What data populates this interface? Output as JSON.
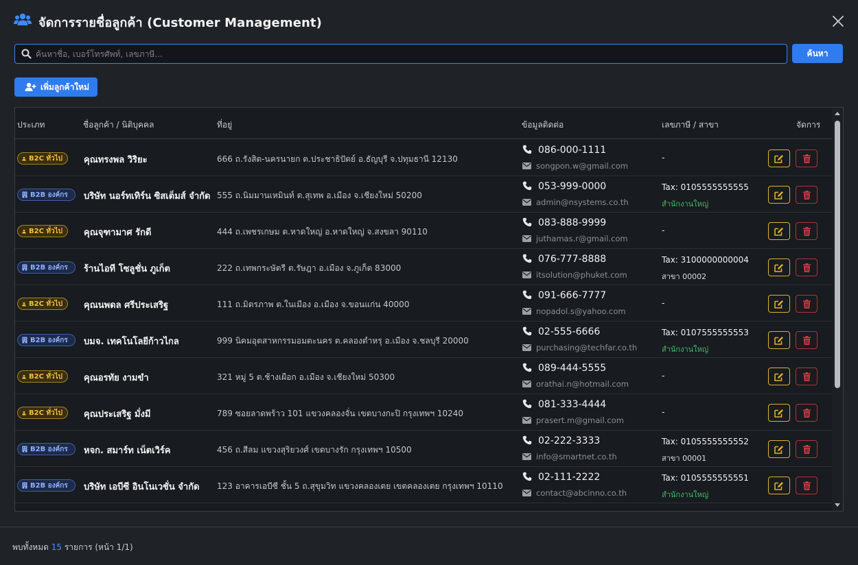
{
  "title": "จัดการรายชื่อลูกค้า (Customer Management)",
  "search": {
    "placeholder": "ค้นหาชื่อ, เบอร์โทรศัพท์, เลขภาษี...",
    "button": "ค้นหา"
  },
  "add_button": "เพิ่มลูกค้าใหม่",
  "columns": {
    "type": "ประเภท",
    "name": "ชื่อลูกค้า / นิติบุคคล",
    "address": "ที่อยู่",
    "contact": "ข้อมูลติดต่อ",
    "tax": "เลขภาษี / สาขา",
    "actions": "จัดการ"
  },
  "rows": [
    {
      "badge": "B2C ทั่วไป",
      "kind": "b2c",
      "name": "คุณทรงพล วิริยะ",
      "address": "666 ถ.รังสิต-นครนายก ต.ประชาธิปัตย์ อ.ธัญบุรี จ.ปทุมธานี 12130",
      "phone": "086-000-1111",
      "email": "songpon.w@gmail.com",
      "tax": "-",
      "branch": ""
    },
    {
      "badge": "B2B องค์กร",
      "kind": "b2b",
      "name": "บริษัท นอร์ทเทิร์น ซิสเต็มส์ จำกัด",
      "address": "555 ถ.นิมมานเหมินท์ ต.สุเทพ อ.เมือง จ.เชียงใหม่ 50200",
      "phone": "053-999-0000",
      "email": "admin@nsystems.co.th",
      "tax": "Tax: 0105555555555",
      "branch": "สำนักงานใหญ่",
      "branch_kind": "hq"
    },
    {
      "badge": "B2C ทั่วไป",
      "kind": "b2c",
      "name": "คุณจุฑามาศ รักดี",
      "address": "444 ถ.เพชรเกษม ต.หาดใหญ่ อ.หาดใหญ่ จ.สงขลา 90110",
      "phone": "083-888-9999",
      "email": "juthamas.r@gmail.com",
      "tax": "-",
      "branch": ""
    },
    {
      "badge": "B2B องค์กร",
      "kind": "b2b",
      "name": "ร้านไอที โซลูชั่น ภูเก็ต",
      "address": "222 ถ.เทพกระษัตรี ต.รัษฎา อ.เมือง จ.ภูเก็ต 83000",
      "phone": "076-777-8888",
      "email": "itsolution@phuket.com",
      "tax": "Tax: 3100000000004",
      "branch": "สาขา 00002",
      "branch_kind": "sub"
    },
    {
      "badge": "B2C ทั่วไป",
      "kind": "b2c",
      "name": "คุณนพดล ศรีประเสริฐ",
      "address": "111 ถ.มิตรภาพ ต.ในเมือง อ.เมือง จ.ขอนแก่น 40000",
      "phone": "091-666-7777",
      "email": "nopadol.s@yahoo.com",
      "tax": "-",
      "branch": ""
    },
    {
      "badge": "B2B องค์กร",
      "kind": "b2b",
      "name": "บมจ. เทคโนโลยีก้าวไกล",
      "address": "999 นิคมอุตสาหกรรมอมตะนคร ต.คลองตำหรุ อ.เมือง จ.ชลบุรี 20000",
      "phone": "02-555-6666",
      "email": "purchasing@techfar.co.th",
      "tax": "Tax: 0107555555553",
      "branch": "สำนักงานใหญ่",
      "branch_kind": "hq"
    },
    {
      "badge": "B2C ทั่วไป",
      "kind": "b2c",
      "name": "คุณอรทัย งามขำ",
      "address": "321 หมู่ 5 ต.ช้างเผือก อ.เมือง จ.เชียงใหม่ 50300",
      "phone": "089-444-5555",
      "email": "orathai.n@hotmail.com",
      "tax": "-",
      "branch": ""
    },
    {
      "badge": "B2C ทั่วไป",
      "kind": "b2c",
      "name": "คุณประเสริฐ มั่งมี",
      "address": "789 ซอยลาดพร้าว 101 แขวงคลองจั่น เขตบางกะปิ กรุงเทพฯ 10240",
      "phone": "081-333-4444",
      "email": "prasert.m@gmail.com",
      "tax": "-",
      "branch": ""
    },
    {
      "badge": "B2B องค์กร",
      "kind": "b2b",
      "name": "หจก. สมาร์ท เน็ตเวิร์ค",
      "address": "456 ถ.สีลม แขวงสุริยวงศ์ เขตบางรัก กรุงเทพฯ 10500",
      "phone": "02-222-3333",
      "email": "info@smartnet.co.th",
      "tax": "Tax: 0105555555552",
      "branch": "สาขา 00001",
      "branch_kind": "sub"
    },
    {
      "badge": "B2B องค์กร",
      "kind": "b2b",
      "name": "บริษัท เอบีซี อินโนเวชั่น จำกัด",
      "address": "123 อาคารเอบีซี ชั้น 5 ถ.สุขุมวิท แขวงคลองเตย เขตคลองเตย กรุงเทพฯ 10110",
      "phone": "02-111-2222",
      "email": "contact@abcinno.co.th",
      "tax": "Tax: 0105555555551",
      "branch": "สำนักงานใหญ่",
      "branch_kind": "hq"
    }
  ],
  "footer": {
    "prefix": "พบทั้งหมด",
    "count": "15",
    "suffix": "รายการ (หน้า 1/1)"
  },
  "colors": {
    "accent": "#2f7bf0",
    "b2c": "#f3c23a",
    "b2b": "#8fb0ff",
    "hq": "#3fbf6a",
    "edit": "#e0b22a",
    "delete": "#d33a45"
  }
}
